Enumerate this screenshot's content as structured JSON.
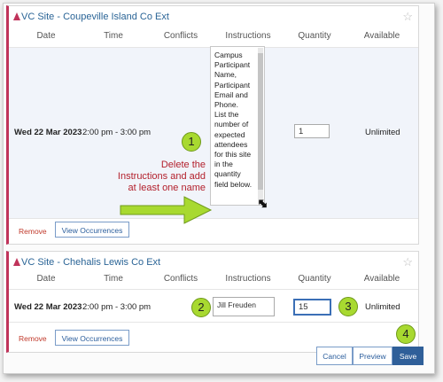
{
  "colors": {
    "accent": "#c0335a",
    "link": "#2a6496",
    "callout": "#a8d930",
    "save": "#2f5f99",
    "note": "#b3202c"
  },
  "headers": {
    "date": "Date",
    "time": "Time",
    "conflicts": "Conflicts",
    "instructions": "Instructions",
    "quantity": "Quantity",
    "available": "Available"
  },
  "site1": {
    "title": "VC Site - Coupeville Island Co Ext",
    "icon": "flask-icon",
    "date": "Wed 22 Mar 2023",
    "time": "2:00 pm - 3:00 pm",
    "instructions_lines": [
      "Campus",
      "Participant",
      "Name,",
      "Participant",
      "Email and",
      "Phone.",
      "List the",
      "number of",
      "expected",
      "attendees",
      "for this site",
      "in the",
      "quantity",
      "field below."
    ],
    "quantity": "1",
    "available": "Unlimited",
    "remove": "Remove",
    "view": "View Occurrences"
  },
  "site2": {
    "title": "VC Site - Chehalis Lewis Co Ext",
    "icon": "flask-icon",
    "date": "Wed 22 Mar 2023",
    "time": "2:00 pm - 3:00 pm",
    "instructions": "Jill Freuden",
    "quantity": "15",
    "available": "Unlimited",
    "remove": "Remove",
    "view": "View Occurrences"
  },
  "annotation": {
    "note_lines": [
      "Delete the",
      "Instructions and add",
      "at least one name"
    ],
    "callouts": [
      "1",
      "2",
      "3",
      "4"
    ]
  },
  "footer": {
    "cancel": "Cancel",
    "preview": "Preview",
    "save": "Save"
  }
}
